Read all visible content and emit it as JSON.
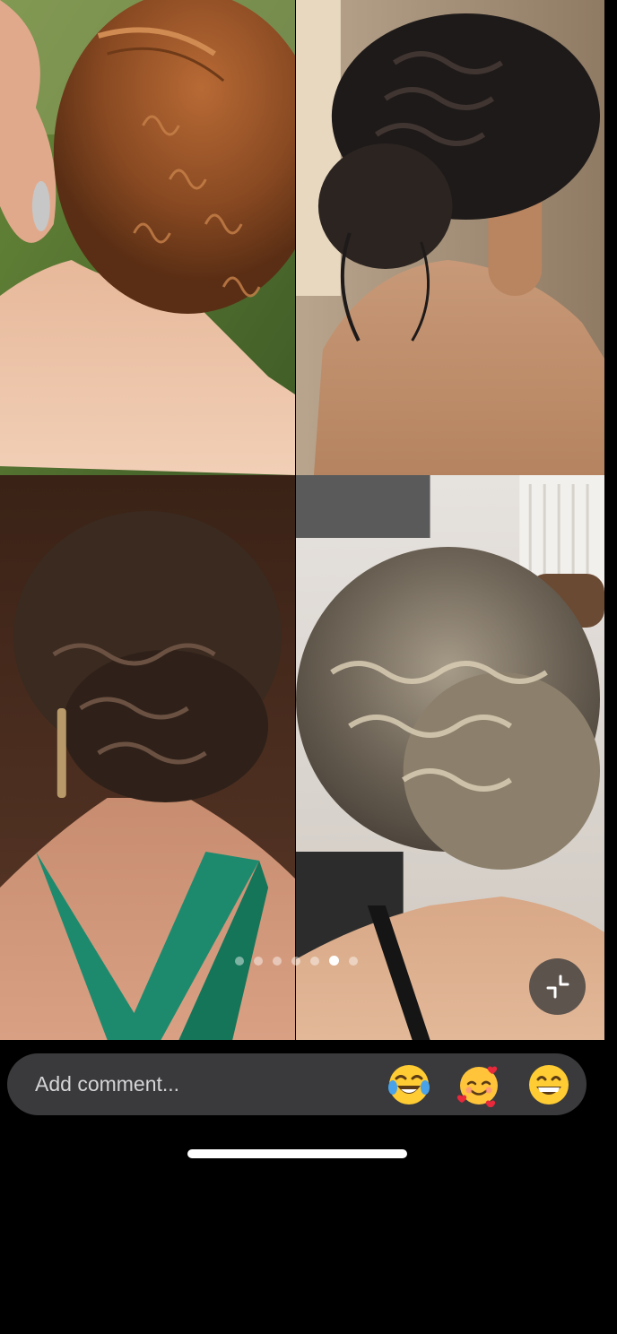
{
  "gallery": {
    "images": [
      {
        "name": "hairstyle-image-1",
        "icon": "photo-red-curly-updo"
      },
      {
        "name": "hairstyle-image-2",
        "icon": "photo-dark-braided-bun"
      },
      {
        "name": "hairstyle-image-3",
        "icon": "photo-brown-braided-bun-green-dress"
      },
      {
        "name": "hairstyle-image-4",
        "icon": "photo-blonde-braided-updo"
      }
    ],
    "pager": {
      "count": 7,
      "active_index": 5
    },
    "collapse_button": {
      "icon": "collapse-icon"
    }
  },
  "comment": {
    "placeholder": "Add comment...",
    "reactions": [
      {
        "icon": "laughing-tears-emoji",
        "glyph": "😂"
      },
      {
        "icon": "smiling-hearts-emoji",
        "glyph": "🥰"
      },
      {
        "icon": "grinning-emoji",
        "glyph": "😁"
      }
    ]
  },
  "colors": {
    "background": "#000000",
    "comment_bar": "#3a3a3c",
    "placeholder_text": "#d4d4d6",
    "active_dot": "#ffffff"
  }
}
